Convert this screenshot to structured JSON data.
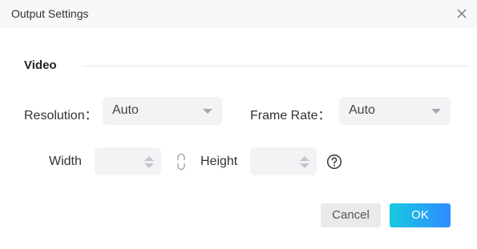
{
  "dialog": {
    "title": "Output Settings"
  },
  "video": {
    "section_title": "Video",
    "resolution_label": "Resolution：",
    "resolution_value": "Auto",
    "frame_rate_label": "Frame Rate：",
    "frame_rate_value": "Auto",
    "width_label": "Width",
    "width_value": "",
    "height_label": "Height",
    "height_value": ""
  },
  "buttons": {
    "cancel_label": "Cancel",
    "ok_label": "OK"
  },
  "icons": {
    "close": "close-icon",
    "link": "link-icon",
    "help": "help-icon",
    "dropdown": "chevron-down-icon"
  },
  "colors": {
    "ok_gradient_start": "#18c9e0",
    "ok_gradient_end": "#2f8cff",
    "field_background": "#f2f3f5"
  }
}
